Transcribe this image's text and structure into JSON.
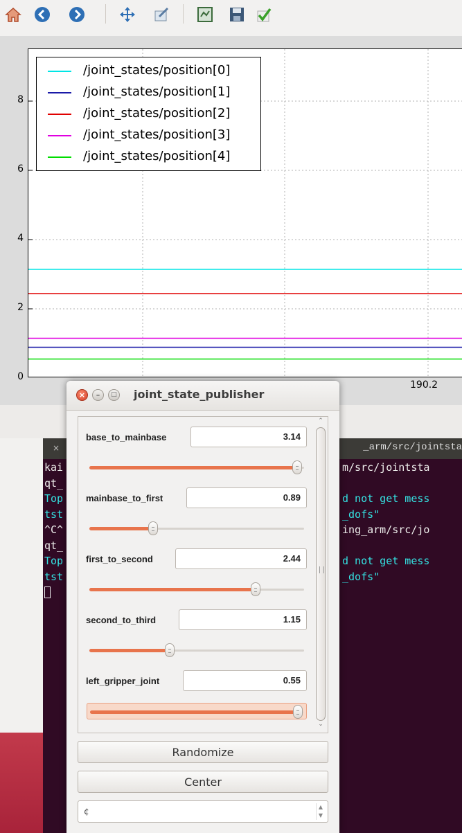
{
  "toolbar": {
    "icons": [
      "home-icon",
      "back-icon",
      "forward-icon",
      "pan-icon",
      "zoom-icon",
      "subplots-icon",
      "save-icon",
      "edit-check-icon"
    ]
  },
  "plot": {
    "chart_data": {
      "type": "line",
      "xlabel": "",
      "ylabel": "",
      "yticks": [
        "0",
        "2",
        "4",
        "6",
        "8"
      ],
      "xticks": [
        "190.2"
      ],
      "ylim": [
        0,
        9.5
      ],
      "grid": true,
      "legend_position": "top-left",
      "series": [
        {
          "name": "/joint_states/position[0]",
          "color": "#00e5e5",
          "y": 3.14
        },
        {
          "name": "/joint_states/position[1]",
          "color": "#1a1aa8",
          "y": 0.89
        },
        {
          "name": "/joint_states/position[2]",
          "color": "#e00000",
          "y": 2.44
        },
        {
          "name": "/joint_states/position[3]",
          "color": "#e000e0",
          "y": 1.15
        },
        {
          "name": "/joint_states/position[4]",
          "color": "#00dd00",
          "y": 0.55
        }
      ]
    }
  },
  "terminal": {
    "tab_close": "×",
    "tab_title": "_arm/src/jointsta",
    "left_lines": [
      {
        "text": "kai",
        "color": "#eeeeec"
      },
      {
        "text": "qt_",
        "color": "#eeeeec"
      },
      {
        "text": "Top",
        "color": "#34e2e2"
      },
      {
        "text": "tst",
        "color": "#34e2e2"
      },
      {
        "text": "^C^",
        "color": "#eeeeec"
      },
      {
        "text": "qt_",
        "color": "#eeeeec"
      },
      {
        "text": "Top",
        "color": "#34e2e2"
      },
      {
        "text": "tst",
        "color": "#34e2e2"
      }
    ],
    "right_lines": [
      {
        "text": "m/src/jointsta",
        "color": "#eeeeec"
      },
      {
        "text": "",
        "color": "#eeeeec"
      },
      {
        "text": "d not get mess",
        "color": "#34e2e2"
      },
      {
        "text": "_dofs\"",
        "color": "#34e2e2"
      },
      {
        "text": "ing_arm/src/jo",
        "color": "#eeeeec"
      },
      {
        "text": "",
        "color": "#eeeeec"
      },
      {
        "text": "d not get mess",
        "color": "#34e2e2"
      },
      {
        "text": "_dofs\"",
        "color": "#34e2e2"
      }
    ]
  },
  "dialog": {
    "title": "joint_state_publisher",
    "joints": [
      {
        "label": "base_to_mainbase",
        "value": "3.14",
        "fraction": 0.98
      },
      {
        "label": "mainbase_to_first",
        "value": "0.89",
        "fraction": 0.29
      },
      {
        "label": "first_to_second",
        "value": "2.44",
        "fraction": 0.78
      },
      {
        "label": "second_to_third",
        "value": "1.15",
        "fraction": 0.37
      },
      {
        "label": "left_gripper_joint",
        "value": "0.55",
        "fraction": 0.98
      }
    ],
    "randomize_label": "Randomize",
    "center_label": "Center",
    "combo_value": "¢"
  }
}
